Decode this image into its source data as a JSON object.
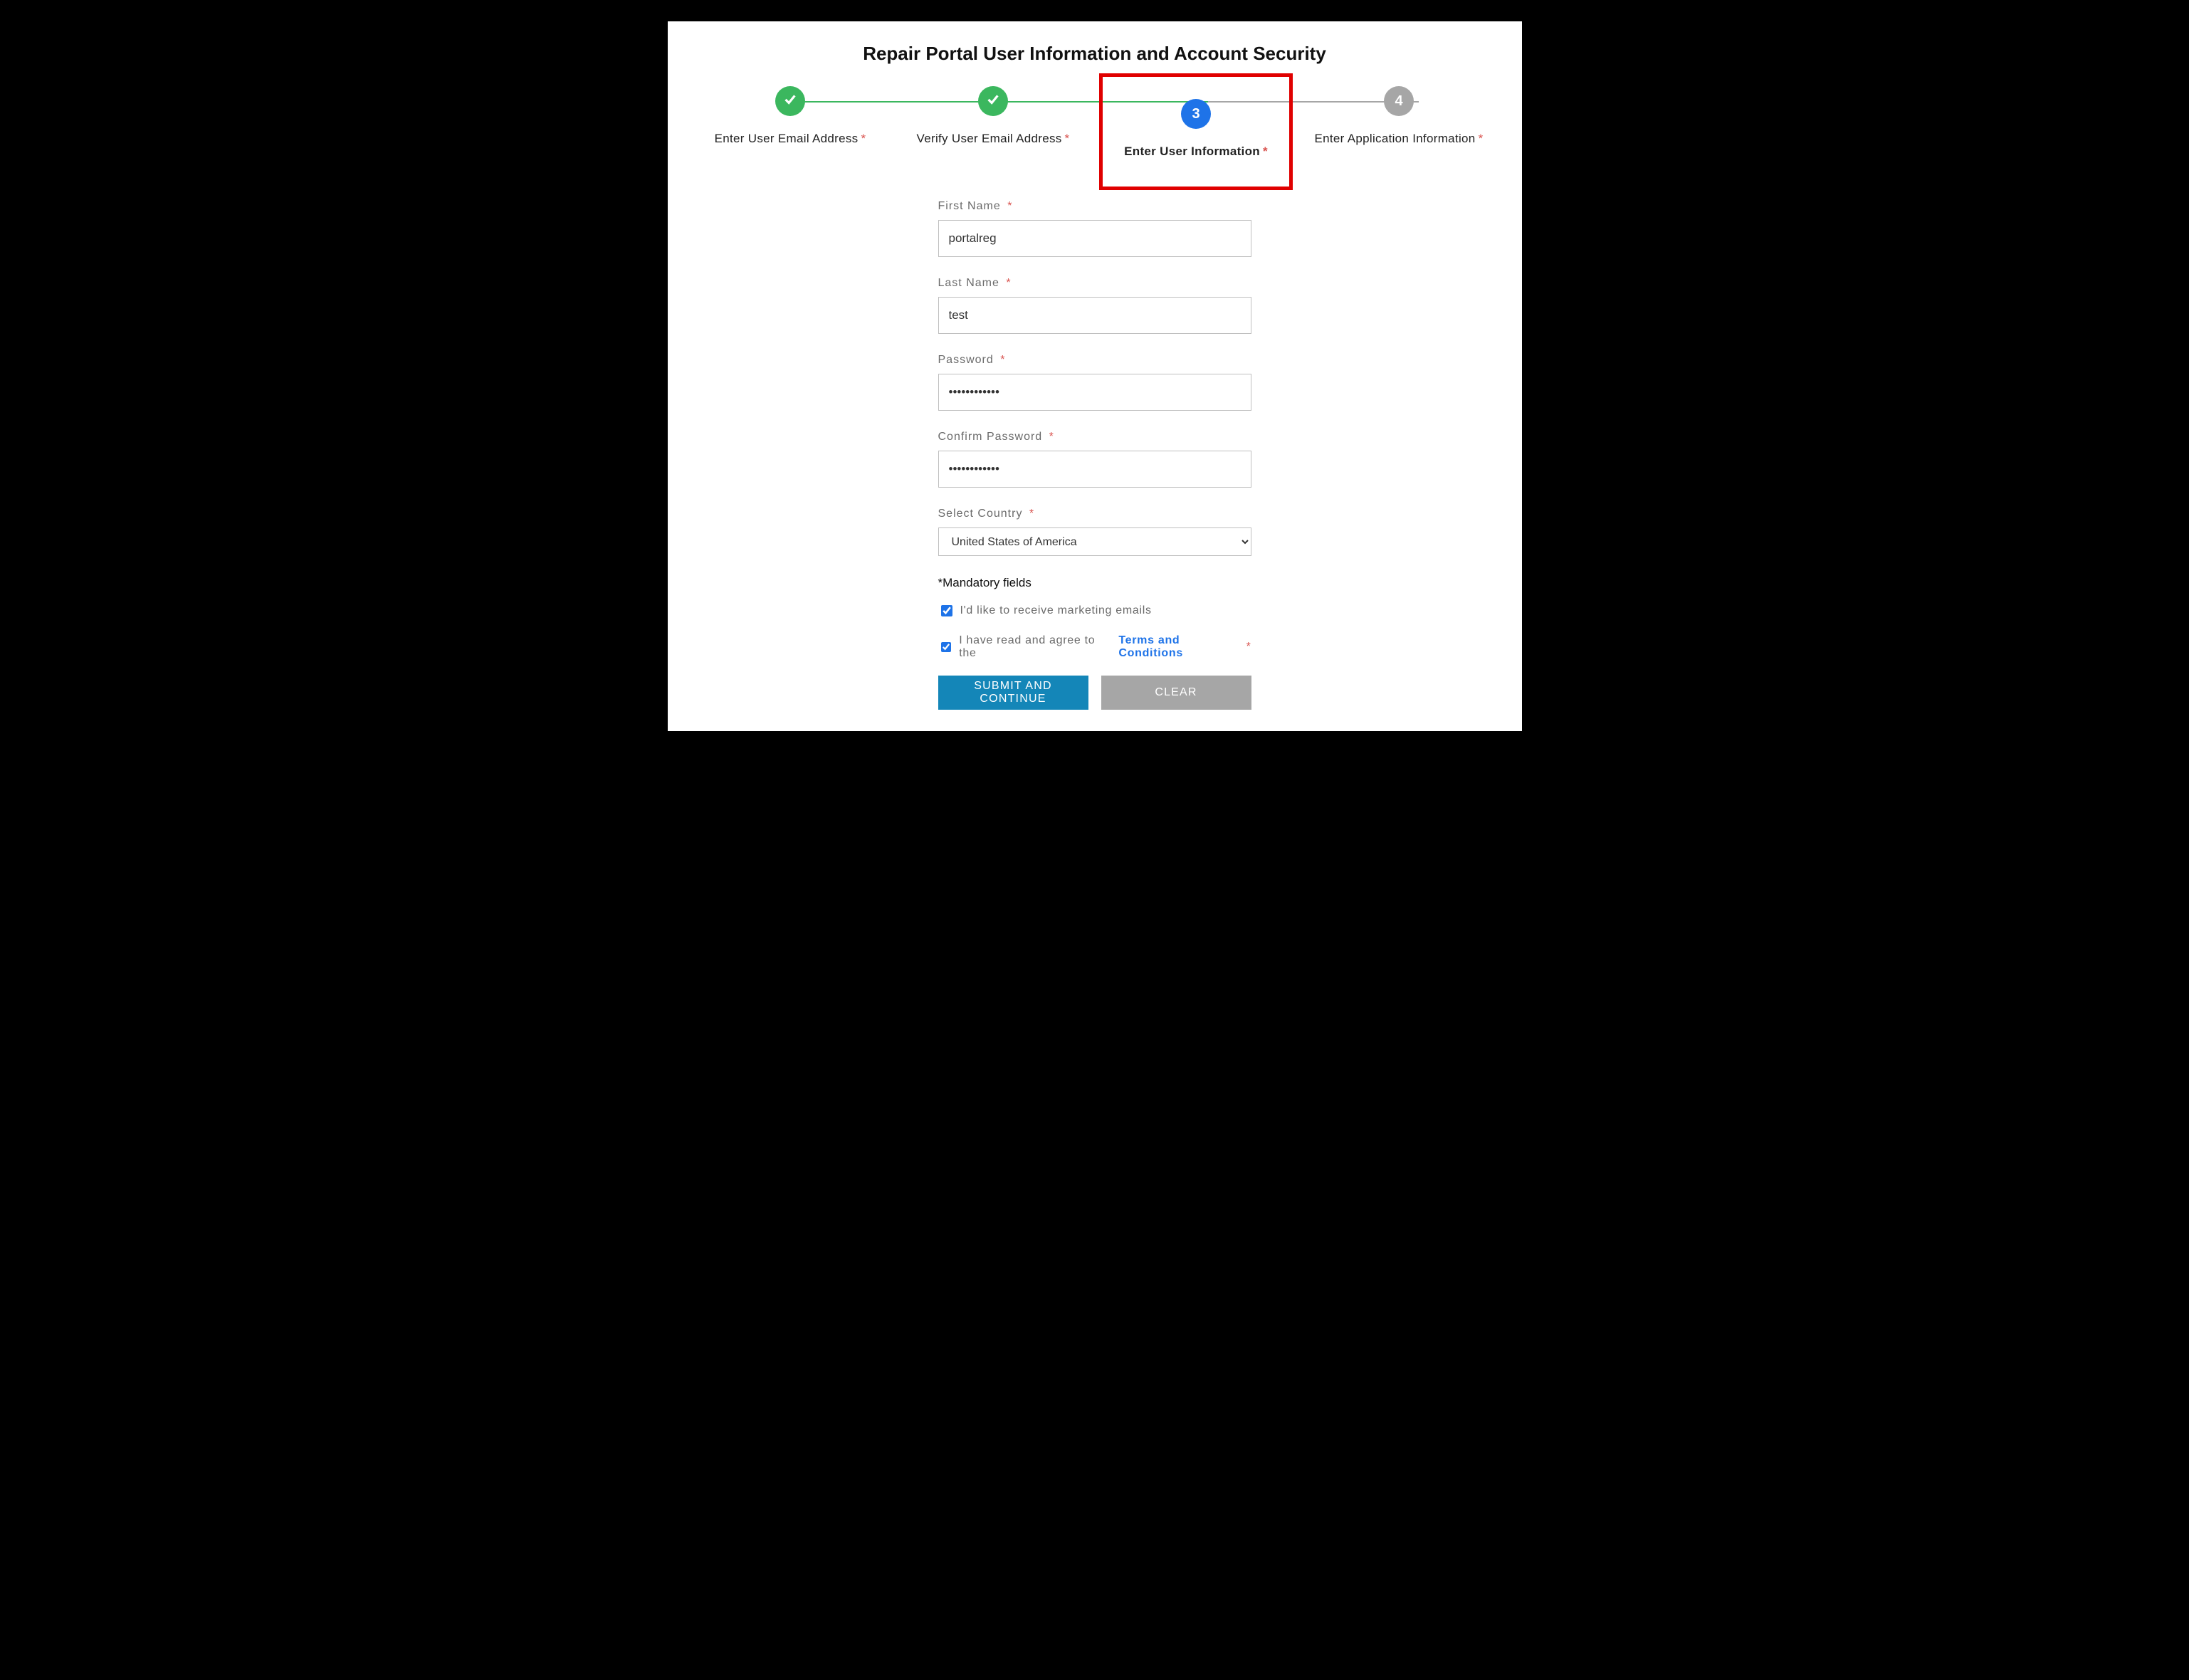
{
  "page": {
    "title": "Repair Portal User Information and Account Security"
  },
  "stepper": {
    "steps": [
      {
        "label": "Enter User Email Address",
        "state": "done",
        "required": true
      },
      {
        "label": "Verify User Email Address",
        "state": "done",
        "required": true
      },
      {
        "label": "Enter User Information",
        "state": "current",
        "required": true,
        "number": "3",
        "highlighted": true
      },
      {
        "label": "Enter Application Information",
        "state": "upcoming",
        "required": true,
        "number": "4"
      }
    ]
  },
  "form": {
    "first_name": {
      "label": "First Name",
      "value": "portalreg"
    },
    "last_name": {
      "label": "Last Name",
      "value": "test"
    },
    "password": {
      "label": "Password",
      "value": "••••••••••••"
    },
    "confirm": {
      "label": "Confirm Password",
      "value": "••••••••••••"
    },
    "country": {
      "label": "Select Country",
      "value": "United States of America"
    },
    "mandatory_note": "*Mandatory fields",
    "marketing_opt_in": {
      "label": "I'd like to receive marketing emails",
      "checked": true
    },
    "terms": {
      "prefix": "I have read and agree to the",
      "link_text": "Terms and Conditions",
      "checked": true,
      "required": true
    },
    "buttons": {
      "submit": "SUBMIT AND CONTINUE",
      "clear": "CLEAR"
    }
  }
}
